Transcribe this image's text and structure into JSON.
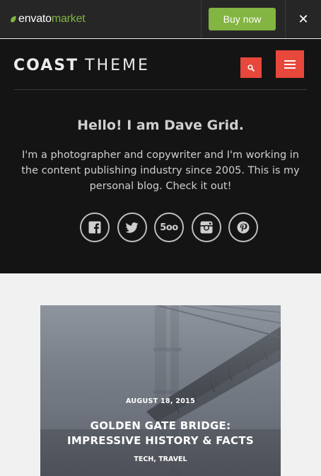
{
  "envato_bar": {
    "logo_envato": "envato",
    "logo_market": "market",
    "buy_label": "Buy now",
    "close_glyph": "✕",
    "brand_green": "#82b541"
  },
  "header": {
    "logo_bold": "COAST",
    "logo_light": "THEME",
    "search_icon": "search-icon",
    "menu_icon": "hamburger-menu-icon",
    "accent": "#e8473b"
  },
  "intro": {
    "greeting": "Hello! I am Dave Grid.",
    "bio": "I'm a photographer and copywriter and I'm working in the content publishing industry since 2005. This is my personal blog. Check it out!"
  },
  "socials": [
    {
      "name": "facebook-icon"
    },
    {
      "name": "twitter-icon"
    },
    {
      "name": "500px-icon",
      "text": "5oo"
    },
    {
      "name": "instagram-icon"
    },
    {
      "name": "pinterest-icon"
    }
  ],
  "post": {
    "date": "AUGUST 18, 2015",
    "title": "GOLDEN GATE BRIDGE: IMPRESSIVE HISTORY & FACTS",
    "categories": [
      "TECH",
      "TRAVEL"
    ],
    "separator": ", "
  }
}
